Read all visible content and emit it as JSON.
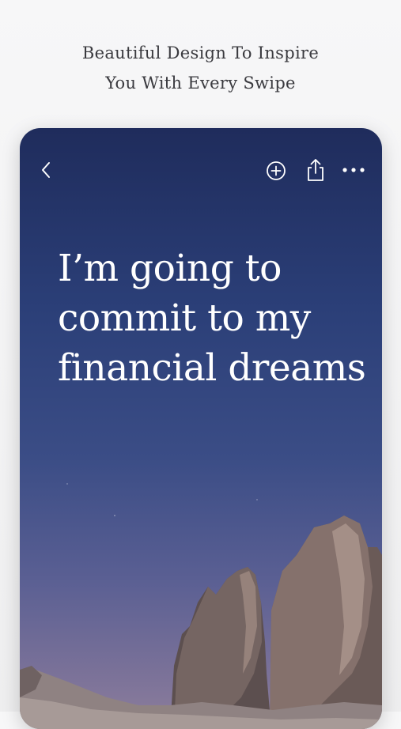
{
  "caption": {
    "line1": "Beautiful Design To Inspire",
    "line2": "You With Every Swipe"
  },
  "card": {
    "quote": "I’m going to commit to my financial dreams",
    "toolbar": {
      "back_icon": "chevron-left-icon",
      "add_icon": "plus-circle-icon",
      "share_icon": "share-icon",
      "more_icon": "more-horizontal-icon"
    },
    "background": "night-sky-mountain-photo"
  },
  "colors": {
    "sky_top": "#1f2c5c",
    "sky_bottom": "#8e7f9c",
    "text": "#ffffff",
    "caption_text": "#3a3a3f"
  }
}
